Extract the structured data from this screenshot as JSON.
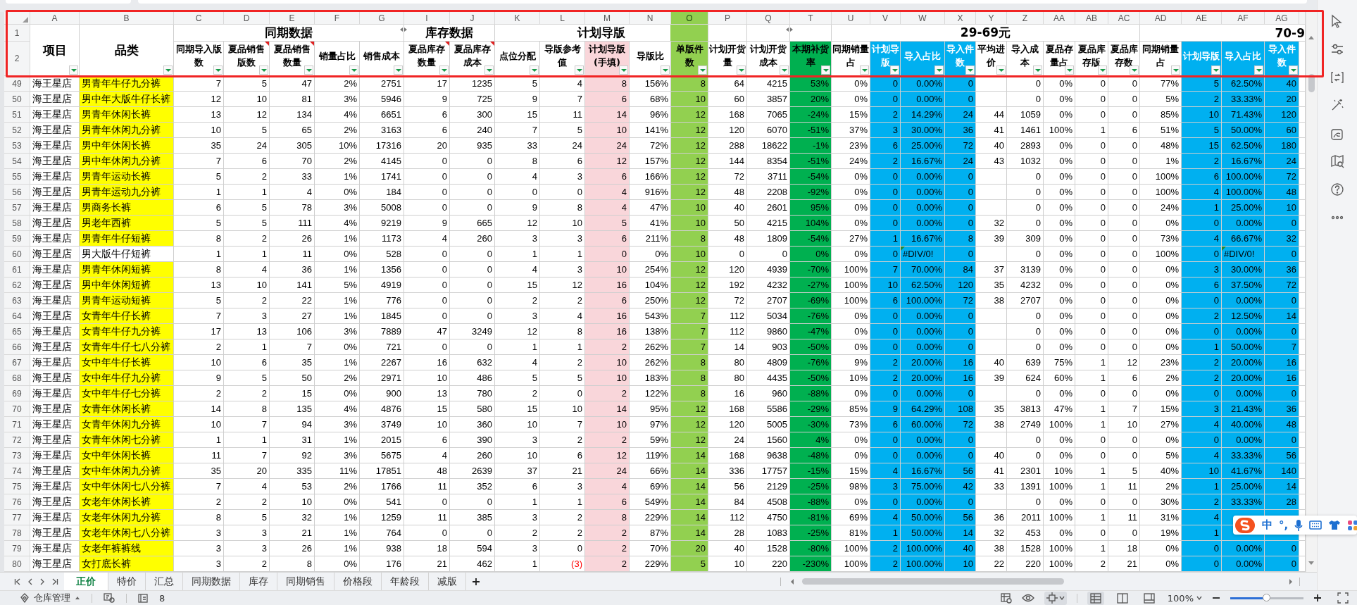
{
  "header_row_numbers": [
    "1",
    "2"
  ],
  "group_headers": [
    {
      "text": "同期数据"
    },
    {
      "text": "库存数据"
    },
    {
      "text": "计划导版"
    },
    {
      "text": "29-69元"
    },
    {
      "text": "70-9"
    }
  ],
  "columns": [
    {
      "letter": "A",
      "title": "项目",
      "comment": false,
      "selected": false
    },
    {
      "letter": "B",
      "title": "品类",
      "comment": false,
      "selected": false
    },
    {
      "letter": "C",
      "title": "同期导入版数",
      "comment": false,
      "selected": false
    },
    {
      "letter": "D",
      "title": "夏品销售版数",
      "comment": true,
      "selected": false
    },
    {
      "letter": "E",
      "title": "夏品销售数量",
      "comment": true,
      "selected": false
    },
    {
      "letter": "F",
      "title": "销量占比",
      "comment": false,
      "selected": false
    },
    {
      "letter": "G",
      "title": "销售成本",
      "comment": false,
      "selected": false
    },
    {
      "letter": "I",
      "title": "夏品库存数量",
      "comment": true,
      "selected": false
    },
    {
      "letter": "J",
      "title": "夏品库存成本",
      "comment": true,
      "selected": false
    },
    {
      "letter": "K",
      "title": "点位分配",
      "comment": false,
      "selected": false
    },
    {
      "letter": "L",
      "title": "导版参考值",
      "comment": false,
      "selected": false
    },
    {
      "letter": "M",
      "title": "计划导版(手填)",
      "comment": false,
      "selected": false
    },
    {
      "letter": "N",
      "title": "导版比",
      "comment": false,
      "selected": false
    },
    {
      "letter": "O",
      "title": "单版件数",
      "comment": false,
      "selected": true
    },
    {
      "letter": "P",
      "title": "计划开货量",
      "comment": false,
      "selected": false
    },
    {
      "letter": "Q",
      "title": "计划开货成本",
      "comment": false,
      "selected": false
    },
    {
      "letter": "T",
      "title": "本期补货率",
      "comment": false,
      "selected": false
    },
    {
      "letter": "U",
      "title": "同期销量占",
      "comment": false,
      "selected": false
    },
    {
      "letter": "V",
      "title": "计划导版",
      "comment": false,
      "selected": false
    },
    {
      "letter": "W",
      "title": "导入占比",
      "comment": false,
      "selected": false
    },
    {
      "letter": "X",
      "title": "导入件数",
      "comment": false,
      "selected": false
    },
    {
      "letter": "Y",
      "title": "平均进价",
      "comment": false,
      "selected": false
    },
    {
      "letter": "Z",
      "title": "导入成本",
      "comment": false,
      "selected": false
    },
    {
      "letter": "AA",
      "title": "夏品存量占",
      "comment": false,
      "selected": false
    },
    {
      "letter": "AB",
      "title": "夏品库存版",
      "comment": false,
      "selected": false
    },
    {
      "letter": "AC",
      "title": "夏品库存数",
      "comment": false,
      "selected": false
    },
    {
      "letter": "AD",
      "title": "同期销量占",
      "comment": false,
      "selected": false
    },
    {
      "letter": "AE",
      "title": "计划导版",
      "comment": false,
      "selected": false
    },
    {
      "letter": "AF",
      "title": "导入占比",
      "comment": false,
      "selected": false
    },
    {
      "letter": "AG",
      "title": "导入件数",
      "comment": false,
      "selected": false
    }
  ],
  "rows": [
    {
      "number": "49",
      "highlighted": true,
      "cells": [
        "海王星店",
        "男青年牛仔九分裤",
        "7",
        "5",
        "47",
        "2%",
        "2751",
        "17",
        "1235",
        "5",
        "4",
        "8",
        "156%",
        "8",
        "64",
        "4215",
        "53%",
        "0%",
        "0",
        "0.00%",
        "0",
        null,
        "0",
        "0%",
        "0",
        "0",
        "77%",
        "5",
        "62.50%",
        "40"
      ]
    },
    {
      "number": "50",
      "highlighted": true,
      "cells": [
        "海王星店",
        "男中年大版牛仔长裤",
        "12",
        "10",
        "81",
        "3%",
        "5946",
        "9",
        "725",
        "9",
        "7",
        "6",
        "68%",
        "10",
        "60",
        "3857",
        "20%",
        "0%",
        "0",
        "0.00%",
        "0",
        null,
        "0",
        "0%",
        "0",
        "0",
        "5%",
        "2",
        "33.33%",
        "20"
      ]
    },
    {
      "number": "51",
      "highlighted": true,
      "cells": [
        "海王星店",
        "男青年休闲长裤",
        "13",
        "12",
        "134",
        "4%",
        "6651",
        "6",
        "300",
        "15",
        "11",
        "14",
        "96%",
        "12",
        "168",
        "7065",
        "-24%",
        "15%",
        "2",
        "14.29%",
        "24",
        "44",
        "1059",
        "0%",
        "0",
        "0",
        "85%",
        "10",
        "71.43%",
        "120"
      ]
    },
    {
      "number": "52",
      "highlighted": true,
      "cells": [
        "海王星店",
        "男青年休闲九分裤",
        "10",
        "5",
        "65",
        "2%",
        "3163",
        "6",
        "240",
        "7",
        "5",
        "10",
        "141%",
        "12",
        "120",
        "6070",
        "-51%",
        "37%",
        "3",
        "30.00%",
        "36",
        "41",
        "1461",
        "100%",
        "1",
        "6",
        "51%",
        "5",
        "50.00%",
        "60"
      ]
    },
    {
      "number": "53",
      "highlighted": true,
      "cells": [
        "海王星店",
        "男中年休闲长裤",
        "35",
        "24",
        "305",
        "10%",
        "17316",
        "20",
        "935",
        "33",
        "24",
        "24",
        "72%",
        "12",
        "288",
        "18622",
        "-1%",
        "23%",
        "6",
        "25.00%",
        "72",
        "40",
        "2893",
        "0%",
        "0",
        "0",
        "48%",
        "15",
        "62.50%",
        "180"
      ]
    },
    {
      "number": "54",
      "highlighted": true,
      "cells": [
        "海王星店",
        "男中年休闲九分裤",
        "7",
        "6",
        "70",
        "2%",
        "4145",
        "0",
        "0",
        "8",
        "6",
        "12",
        "157%",
        "12",
        "144",
        "8354",
        "-51%",
        "24%",
        "2",
        "16.67%",
        "24",
        "43",
        "1032",
        "0%",
        "0",
        "0",
        "1%",
        "2",
        "16.67%",
        "24"
      ]
    },
    {
      "number": "55",
      "highlighted": true,
      "cells": [
        "海王星店",
        "男青年运动长裤",
        "5",
        "2",
        "33",
        "1%",
        "1741",
        "0",
        "0",
        "4",
        "3",
        "6",
        "166%",
        "12",
        "72",
        "3711",
        "-54%",
        "0%",
        "0",
        "0.00%",
        "0",
        null,
        "0",
        "0%",
        "0",
        "0",
        "100%",
        "6",
        "100.00%",
        "72"
      ]
    },
    {
      "number": "56",
      "highlighted": true,
      "cells": [
        "海王星店",
        "男青年运动九分裤",
        "1",
        "1",
        "4",
        "0%",
        "184",
        "0",
        "0",
        "0",
        "0",
        "4",
        "916%",
        "12",
        "48",
        "2208",
        "-92%",
        "0%",
        "0",
        "0.00%",
        "0",
        null,
        "0",
        "0%",
        "0",
        "0",
        "100%",
        "4",
        "100.00%",
        "48"
      ]
    },
    {
      "number": "57",
      "highlighted": true,
      "cells": [
        "海王星店",
        "男商务长裤",
        "6",
        "5",
        "78",
        "3%",
        "5008",
        "0",
        "0",
        "9",
        "8",
        "4",
        "47%",
        "10",
        "40",
        "2601",
        "95%",
        "0%",
        "0",
        "0.00%",
        "0",
        null,
        "0",
        "0%",
        "0",
        "0",
        "24%",
        "1",
        "25.00%",
        "10"
      ]
    },
    {
      "number": "58",
      "highlighted": true,
      "cells": [
        "海王星店",
        "男老年西裤",
        "5",
        "5",
        "111",
        "4%",
        "9219",
        "9",
        "665",
        "12",
        "10",
        "5",
        "41%",
        "10",
        "50",
        "4215",
        "104%",
        "0%",
        "0",
        "0.00%",
        "0",
        "32",
        "0",
        "0%",
        "0",
        "0",
        "0%",
        "0",
        "0.00%",
        "0"
      ]
    },
    {
      "number": "59",
      "highlighted": true,
      "cells": [
        "海王星店",
        "男青年牛仔短裤",
        "8",
        "2",
        "26",
        "1%",
        "1173",
        "4",
        "260",
        "3",
        "3",
        "6",
        "211%",
        "8",
        "48",
        "1809",
        "-54%",
        "27%",
        "1",
        "16.67%",
        "8",
        "39",
        "309",
        "0%",
        "0",
        "0",
        "73%",
        "4",
        "66.67%",
        "32"
      ]
    },
    {
      "number": "60",
      "highlighted": false,
      "cells": [
        "海王星店",
        "男大版牛仔短裤",
        "1",
        "1",
        "11",
        "0%",
        "528",
        "0",
        "0",
        "1",
        "1",
        "0",
        "0%",
        "10",
        "0",
        "0",
        "0%",
        "0%",
        "0",
        {
          "text": "#DIV/0!",
          "error": true
        },
        "0",
        null,
        "0",
        "0%",
        "0",
        "0",
        "100%",
        "0",
        {
          "text": "#DIV/0!",
          "error": true
        },
        "0"
      ]
    },
    {
      "number": "61",
      "highlighted": true,
      "cells": [
        "海王星店",
        "男青年休闲短裤",
        "8",
        "4",
        "36",
        "1%",
        "1356",
        "0",
        "0",
        "4",
        "3",
        "10",
        "254%",
        "12",
        "120",
        "4939",
        "-70%",
        "100%",
        "7",
        "70.00%",
        "84",
        "37",
        "3139",
        "0%",
        "0",
        "0",
        "0%",
        "3",
        "30.00%",
        "36"
      ]
    },
    {
      "number": "62",
      "highlighted": true,
      "cells": [
        "海王星店",
        "男中年休闲短裤",
        "13",
        "10",
        "141",
        "5%",
        "4919",
        "0",
        "0",
        "15",
        "12",
        "16",
        "104%",
        "12",
        "192",
        "4232",
        "-27%",
        "100%",
        "10",
        "62.50%",
        "120",
        "35",
        "4232",
        "0%",
        "0",
        "0",
        "0%",
        "6",
        "37.50%",
        "72"
      ]
    },
    {
      "number": "63",
      "highlighted": true,
      "cells": [
        "海王星店",
        "男青年运动短裤",
        "5",
        "2",
        "22",
        "1%",
        "776",
        "0",
        "0",
        "2",
        "2",
        "6",
        "250%",
        "12",
        "72",
        "2707",
        "-69%",
        "100%",
        "6",
        "100.00%",
        "72",
        "38",
        "2707",
        "0%",
        "0",
        "0",
        "0%",
        "0",
        "0.00%",
        "0"
      ]
    },
    {
      "number": "64",
      "highlighted": true,
      "cells": [
        "海王星店",
        "女青年牛仔长裤",
        "7",
        "3",
        "27",
        "1%",
        "1845",
        "0",
        "0",
        "3",
        "4",
        "16",
        "543%",
        "7",
        "112",
        "5034",
        "-76%",
        "0%",
        "0",
        "0.00%",
        "0",
        null,
        "0",
        "0%",
        "0",
        "0",
        "0%",
        "2",
        "12.50%",
        "14"
      ]
    },
    {
      "number": "65",
      "highlighted": true,
      "cells": [
        "海王星店",
        "女青年牛仔九分裤",
        "17",
        "13",
        "106",
        "3%",
        "7889",
        "47",
        "3249",
        "12",
        "8",
        "16",
        "138%",
        "7",
        "112",
        "9860",
        "-47%",
        "0%",
        "0",
        "0.00%",
        "0",
        null,
        "0",
        "0%",
        "0",
        "0",
        "0%",
        "0",
        "0.00%",
        "0"
      ]
    },
    {
      "number": "66",
      "highlighted": true,
      "cells": [
        "海王星店",
        "女青年牛仔七八分裤",
        "2",
        "1",
        "7",
        "0%",
        "721",
        "0",
        "0",
        "1",
        "1",
        "2",
        "262%",
        "7",
        "14",
        "903",
        "-50%",
        "0%",
        "0",
        "0.00%",
        "0",
        null,
        "0",
        "0%",
        "0",
        "0",
        "0%",
        "1",
        "50.00%",
        "7"
      ]
    },
    {
      "number": "67",
      "highlighted": true,
      "cells": [
        "海王星店",
        "女中年牛仔长裤",
        "10",
        "6",
        "35",
        "1%",
        "2267",
        "16",
        "632",
        "4",
        "2",
        "10",
        "262%",
        "8",
        "80",
        "4809",
        "-76%",
        "9%",
        "2",
        "20.00%",
        "16",
        "40",
        "639",
        "75%",
        "1",
        "12",
        "23%",
        "2",
        "20.00%",
        "16"
      ]
    },
    {
      "number": "68",
      "highlighted": true,
      "cells": [
        "海王星店",
        "女中年牛仔九分裤",
        "9",
        "5",
        "50",
        "2%",
        "2971",
        "10",
        "486",
        "5",
        "5",
        "10",
        "183%",
        "8",
        "80",
        "4435",
        "-50%",
        "10%",
        "2",
        "20.00%",
        "16",
        "39",
        "624",
        "60%",
        "1",
        "6",
        "2%",
        "2",
        "20.00%",
        "16"
      ]
    },
    {
      "number": "69",
      "highlighted": true,
      "cells": [
        "海王星店",
        "女中年牛仔七分裤",
        "2",
        "2",
        "15",
        "0%",
        "900",
        "13",
        "780",
        "2",
        "0",
        "2",
        "122%",
        "8",
        "16",
        "960",
        "-88%",
        "0%",
        "0",
        "0.00%",
        "0",
        null,
        "0",
        "0%",
        "0",
        "0",
        "0%",
        "0",
        "0.00%",
        "0"
      ]
    },
    {
      "number": "70",
      "highlighted": true,
      "cells": [
        "海王星店",
        "女青年休闲长裤",
        "14",
        "8",
        "135",
        "4%",
        "4876",
        "15",
        "580",
        "15",
        "10",
        "14",
        "95%",
        "12",
        "168",
        "5586",
        "-29%",
        "85%",
        "9",
        "64.29%",
        "108",
        "35",
        "3813",
        "47%",
        "1",
        "7",
        "15%",
        "3",
        "21.43%",
        "36"
      ]
    },
    {
      "number": "71",
      "highlighted": true,
      "cells": [
        "海王星店",
        "女青年休闲九分裤",
        "10",
        "7",
        "94",
        "3%",
        "3749",
        "10",
        "360",
        "10",
        "7",
        "10",
        "97%",
        "12",
        "120",
        "5005",
        "-30%",
        "73%",
        "6",
        "60.00%",
        "72",
        "38",
        "2749",
        "100%",
        "1",
        "10",
        "27%",
        "4",
        "40.00%",
        "48"
      ]
    },
    {
      "number": "72",
      "highlighted": true,
      "cells": [
        "海王星店",
        "女青年休闲七分裤",
        "1",
        "1",
        "31",
        "1%",
        "2015",
        "6",
        "390",
        "3",
        "2",
        "2",
        "59%",
        "12",
        "24",
        "1560",
        "4%",
        "0%",
        "0",
        "0.00%",
        "0",
        null,
        "0",
        "0%",
        "0",
        "0",
        "0%",
        "0",
        "0.00%",
        "0"
      ]
    },
    {
      "number": "73",
      "highlighted": true,
      "cells": [
        "海王星店",
        "女中年休闲长裤",
        "11",
        "7",
        "92",
        "3%",
        "5675",
        "4",
        "260",
        "10",
        "6",
        "12",
        "119%",
        "14",
        "168",
        "9638",
        "-48%",
        "0%",
        "0",
        "0.00%",
        "0",
        "40",
        "0",
        "0%",
        "0",
        "0",
        "5%",
        "4",
        "33.33%",
        "56"
      ]
    },
    {
      "number": "74",
      "highlighted": true,
      "cells": [
        "海王星店",
        "女中年休闲九分裤",
        "35",
        "20",
        "335",
        "11%",
        "17851",
        "48",
        "2639",
        "37",
        "21",
        "24",
        "66%",
        "14",
        "336",
        "17757",
        "-15%",
        "15%",
        "4",
        "16.67%",
        "56",
        "41",
        "2301",
        "10%",
        "1",
        "5",
        "40%",
        "10",
        "41.67%",
        "140"
      ]
    },
    {
      "number": "75",
      "highlighted": true,
      "cells": [
        "海王星店",
        "女中年休闲七八分裤",
        "7",
        "4",
        "53",
        "2%",
        "1766",
        "11",
        "352",
        "6",
        "3",
        "4",
        "69%",
        "14",
        "56",
        "2129",
        "-25%",
        "98%",
        "3",
        "75.00%",
        "42",
        "33",
        "1391",
        "100%",
        "1",
        "11",
        "2%",
        "1",
        "25.00%",
        "14"
      ]
    },
    {
      "number": "76",
      "highlighted": true,
      "cells": [
        "海王星店",
        "女老年休闲长裤",
        "2",
        "2",
        "10",
        "0%",
        "541",
        "0",
        "0",
        "1",
        "1",
        "6",
        "549%",
        "14",
        "84",
        "4508",
        "-88%",
        "0%",
        "0",
        "0.00%",
        "0",
        null,
        "0",
        "0%",
        "0",
        "0",
        "30%",
        "2",
        "33.33%",
        "28"
      ]
    },
    {
      "number": "77",
      "highlighted": true,
      "cells": [
        "海王星店",
        "女老年休闲九分裤",
        "8",
        "5",
        "32",
        "1%",
        "1259",
        "11",
        "385",
        "3",
        "2",
        "8",
        "229%",
        "14",
        "112",
        "4750",
        "-81%",
        "69%",
        "4",
        "50.00%",
        "56",
        "36",
        "2011",
        "100%",
        "1",
        "11",
        "31%",
        "4",
        null,
        null
      ]
    },
    {
      "number": "78",
      "highlighted": true,
      "cells": [
        "海王星店",
        "女老年休闲七八分裤",
        "3",
        "3",
        "21",
        "1%",
        "764",
        "0",
        "0",
        "2",
        "2",
        "2",
        "87%",
        "14",
        "28",
        "1083",
        "-25%",
        "81%",
        "1",
        "50.00%",
        "14",
        "32",
        "453",
        "0%",
        "0",
        "0",
        "19%",
        "1",
        null,
        null
      ]
    },
    {
      "number": "79",
      "highlighted": true,
      "cells": [
        "海王星店",
        "女老年裤裤线",
        "3",
        "3",
        "26",
        "1%",
        "938",
        "18",
        "594",
        "3",
        "0",
        "2",
        "70%",
        "20",
        "40",
        "1528",
        "-80%",
        "100%",
        "2",
        "100.00%",
        "40",
        "38",
        "1528",
        "100%",
        "1",
        "18",
        "0%",
        "0",
        "0.00%",
        "0"
      ]
    },
    {
      "number": "80",
      "highlighted": true,
      "cells": [
        "海王星店",
        "女打底长裤",
        "3",
        "2",
        "8",
        "0%",
        "176",
        "21",
        "462",
        "1",
        {
          "text": "(3)",
          "negative": true
        },
        "2",
        "229%",
        "5",
        "10",
        "220",
        "-230%",
        "100%",
        "2",
        "100.00%",
        "10",
        "22",
        "220",
        "100%",
        "2",
        "21",
        "0%",
        "0",
        "0.00%",
        "0"
      ]
    }
  ],
  "sheet_tabs": [
    {
      "label": "正价",
      "selected": true
    },
    {
      "label": "特价",
      "selected": false
    },
    {
      "label": "汇总",
      "selected": false
    },
    {
      "label": "同期数据",
      "selected": false
    },
    {
      "label": "库存",
      "selected": false
    },
    {
      "label": "同期销售",
      "selected": false
    },
    {
      "label": "价格段",
      "selected": false
    },
    {
      "label": "年龄段",
      "selected": false
    },
    {
      "label": "减版",
      "selected": false
    }
  ],
  "status_bar": {
    "workbook": "仓库管理",
    "sheet_count": "8",
    "zoom": "100%",
    "zoom_slider": {
      "level": 0.5
    },
    "view_buttons": [
      {
        "selected": true
      },
      {
        "selected": false
      },
      {
        "selected": false
      }
    ]
  },
  "ime_toolbar": {
    "mode": "中",
    "punctuation": "°,"
  },
  "annotations": [
    {
      "kind": "rectangle"
    }
  ]
}
